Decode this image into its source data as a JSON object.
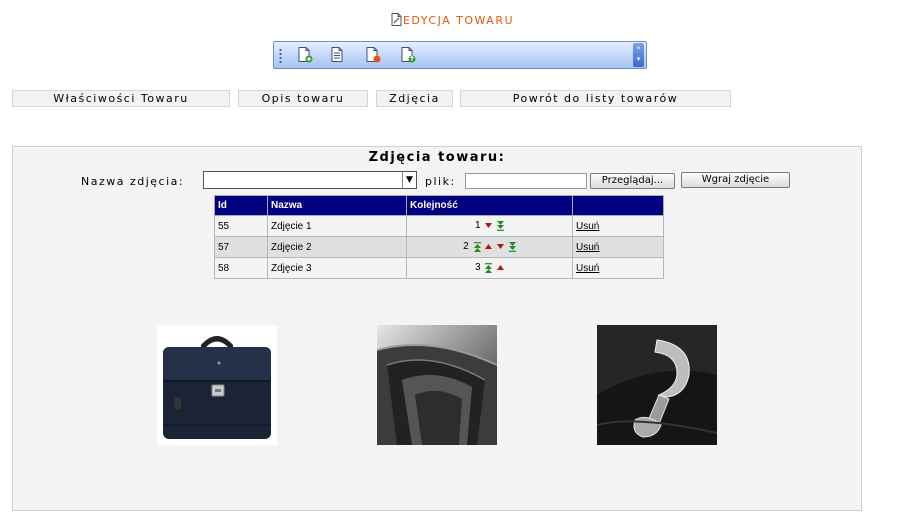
{
  "header": {
    "title": "EDYCJA TOWARU"
  },
  "toolbar": {
    "buttons": [
      {
        "name": "add-document-icon"
      },
      {
        "name": "list-document-icon"
      },
      {
        "name": "delete-document-icon"
      },
      {
        "name": "refresh-document-icon"
      }
    ]
  },
  "tabs": [
    {
      "label": "Właściwości Towaru"
    },
    {
      "label": "Opis towaru"
    },
    {
      "label": "Zdjęcia"
    },
    {
      "label": "Powrót do listy towarów"
    }
  ],
  "panel": {
    "title": "Zdjęcia towaru:",
    "name_label": "Nazwa zdjęcia:",
    "name_value": "",
    "file_label": "plik:",
    "file_value": "",
    "browse_button": "Przeglądaj...",
    "upload_button": "Wgraj zdjęcie"
  },
  "table": {
    "headers": [
      "Id",
      "Nazwa",
      "Kolejność",
      ""
    ],
    "rows": [
      {
        "id": "55",
        "name": "Zdjęcie 1",
        "order": "1",
        "delete": "Usuń"
      },
      {
        "id": "57",
        "name": "Zdjęcie 2",
        "order": "2",
        "delete": "Usuń"
      },
      {
        "id": "58",
        "name": "Zdjęcie 3",
        "order": "3",
        "delete": "Usuń"
      }
    ]
  },
  "photos": [
    {
      "name": "briefcase-front-photo"
    },
    {
      "name": "briefcase-interior-photo"
    },
    {
      "name": "briefcase-clasp-photo"
    }
  ],
  "colors": {
    "header_text": "#e05a10",
    "table_header_bg": "#000080",
    "arrow_up": "#1e8c1e",
    "arrow_down": "#b01818"
  }
}
